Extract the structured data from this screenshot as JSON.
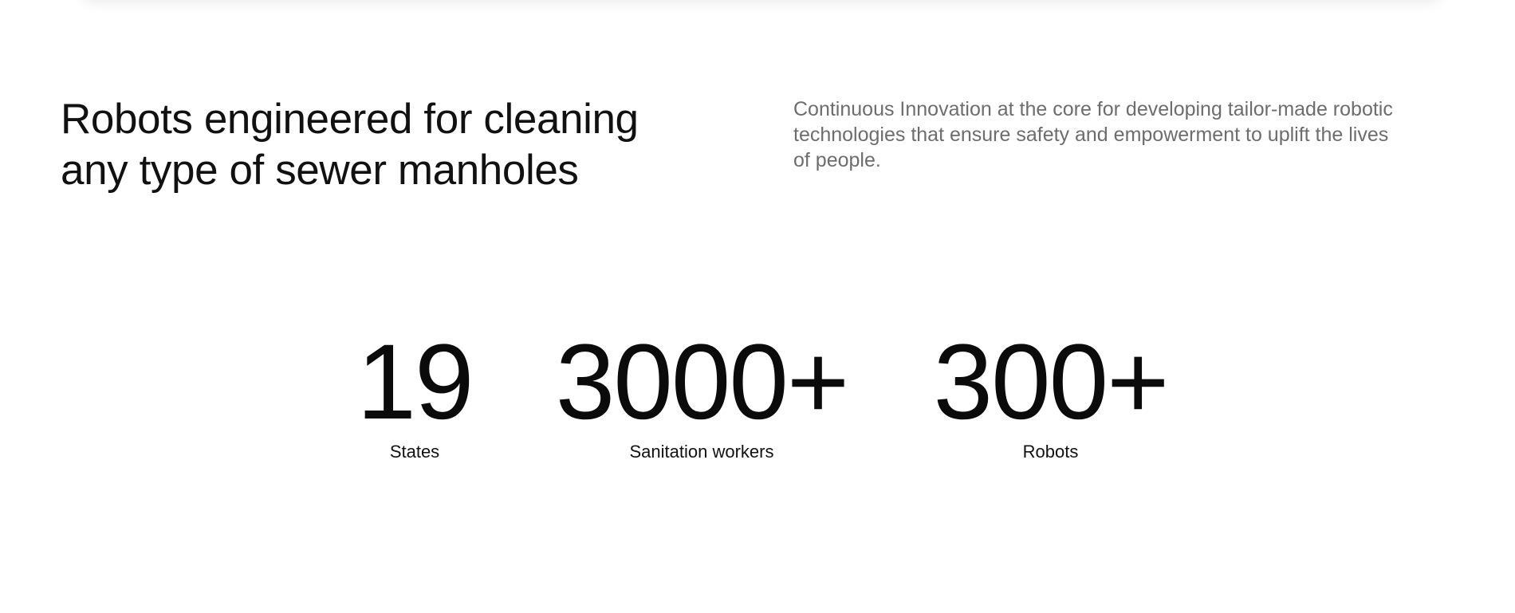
{
  "intro": {
    "headline_line_1": "Robots engineered for cleaning",
    "headline_line_2": "any type of sewer manholes",
    "description_line_1": "Continuous Innovation at the core for developing tailor-made robotic",
    "description_line_2": "technologies that ensure safety and empowerment to uplift the lives",
    "description_line_3": "of people."
  },
  "stats": {
    "items": [
      {
        "value": "19",
        "label": "States"
      },
      {
        "value": "3000+",
        "label": "Sanitation workers"
      },
      {
        "value": "300+",
        "label": "Robots"
      }
    ]
  },
  "colors": {
    "background": "#ffffff",
    "heading": "#111111",
    "body_text": "#6d6d6d",
    "statistic": "#0b0b0b"
  }
}
